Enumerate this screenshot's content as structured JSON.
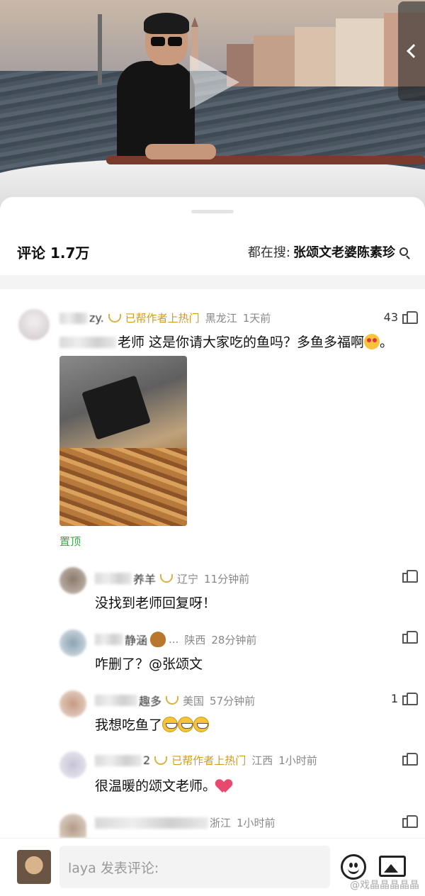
{
  "comments_header": {
    "count_label": "评论 1.7万",
    "trending_prefix": "都在搜:",
    "trending_query": "张颂文老婆陈素珍"
  },
  "comments": [
    {
      "name": "zy.",
      "hot_badge": "已帮作者上热门",
      "region": "黑龙江",
      "time": "1天前",
      "likes": "43",
      "text": "老师 这是你请大家吃的鱼吗？多鱼多福啊",
      "text_suffix": "。",
      "pinned_label": "置顶"
    }
  ],
  "replies": [
    {
      "name": "养羊",
      "region": "辽宁",
      "time": "11分钟前",
      "likes": "",
      "text": "没找到老师回复呀！"
    },
    {
      "name": "静涵",
      "name_suffix": "...",
      "region": "陕西",
      "time": "28分钟前",
      "likes": "",
      "text": "咋删了？@张颂文"
    },
    {
      "name": "趣多",
      "region": "美国",
      "time": "57分钟前",
      "likes": "1",
      "text": "我想吃鱼了"
    },
    {
      "name": "2",
      "hot_badge": "已帮作者上热门",
      "region": "江西",
      "time": "1小时前",
      "likes": "",
      "text": "很温暖的颂文老师。"
    },
    {
      "name": "",
      "region": "浙江",
      "time": "1小时前",
      "likes": "",
      "text": ""
    }
  ],
  "composer": {
    "placeholder": "laya 发表评论:"
  },
  "watermark": "@戏晶晶晶晶晶",
  "colors": {
    "hot_badge": "#d49a1e",
    "pinned": "#3aa64b",
    "vip": "#d9b24a"
  }
}
